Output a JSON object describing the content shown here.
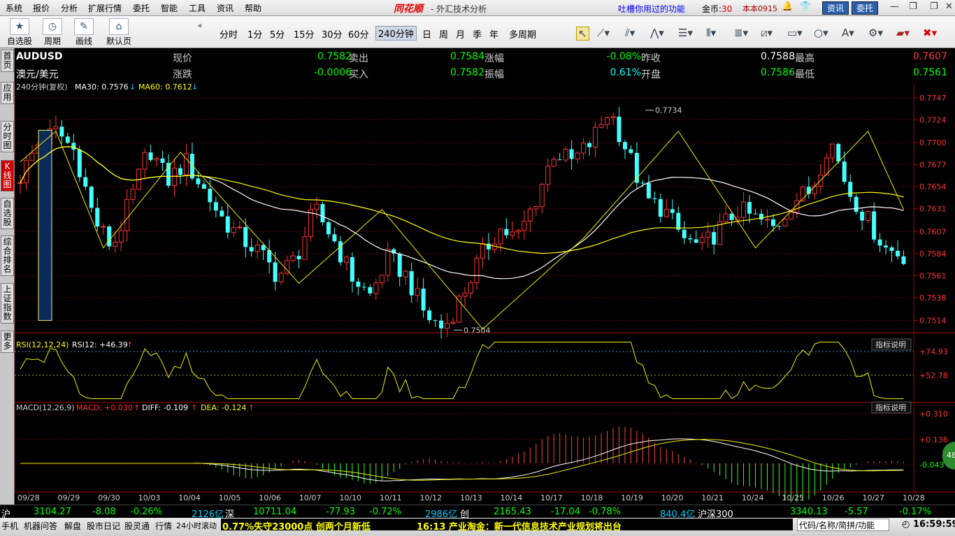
{
  "menu": [
    "系统",
    "报价",
    "分析",
    "扩展行情",
    "委托",
    "智能",
    "工具",
    "资讯",
    "帮助"
  ],
  "app": {
    "logo": "同花顺",
    "subtitle": "- 外汇技术分析",
    "tip": "吐槽你用过的功能",
    "coins_label": "金币:",
    "coins_value": "30",
    "version": "本本0915",
    "btn_news": "资讯",
    "btn_trade": "委托"
  },
  "toolbar": {
    "groups": [
      {
        "label": "自选股",
        "icon": "star-icon"
      },
      {
        "label": "周期",
        "icon": "clock-icon"
      },
      {
        "label": "画线",
        "icon": "pencil-icon"
      },
      {
        "label": "默认页",
        "icon": "home-icon"
      }
    ],
    "periods": [
      "分时",
      "1分",
      "5分",
      "15分",
      "30分",
      "60分",
      "240分钟",
      "日",
      "周",
      "月",
      "季",
      "年",
      "多周期"
    ],
    "selected_period": "240分钟"
  },
  "left_tabs": [
    "首页",
    "应用",
    "分时图",
    "K线图",
    "自选股",
    "综合排名",
    "上证指数",
    "更多"
  ],
  "quote": {
    "symbol": "AUDUSD",
    "name": "澳元/美元",
    "rows": [
      {
        "l1": "现价",
        "v1": "0.7582",
        "l2": "卖出",
        "v2": "0.7584",
        "l3": "涨幅",
        "v3": "-0.08%",
        "l4": "昨收",
        "v4": "0.7588",
        "l5": "最高",
        "v5": "0.7607"
      },
      {
        "l1": "涨跌",
        "v1": "-0.0006",
        "l2": "买入",
        "v2": "0.7582",
        "l3": "振幅",
        "v3": "0.61%",
        "l4": "开盘",
        "v4": "0.7586",
        "l5": "最低",
        "v5": "0.7561"
      }
    ]
  },
  "chart_data": {
    "type": "candlestick",
    "period_label": "240分钟(复权)",
    "ma_legend": [
      {
        "text": "MA30: 0.7576",
        "color": "#ffffff"
      },
      {
        "text": "MA60: 0.7612",
        "color": "#ffff00"
      }
    ],
    "price_axis": [
      "0.7747",
      "0.7724",
      "0.7700",
      "0.7677",
      "0.7654",
      "0.7631",
      "0.7607",
      "0.7584",
      "0.7561",
      "0.7538",
      "0.7514"
    ],
    "ylim": [
      0.7502,
      0.7755
    ],
    "high_label": "0.7734",
    "low_label": "0.7504",
    "dates": [
      "09/28",
      "09/29",
      "09/30",
      "10/03",
      "10/04",
      "10/05",
      "10/06",
      "10/07",
      "10/10",
      "10/11",
      "10/12",
      "10/13",
      "10/14",
      "10/17",
      "10/18",
      "10/19",
      "10/20",
      "10/21",
      "10/24",
      "10/25",
      "10/26",
      "10/27",
      "10/28"
    ],
    "close_path": [
      0.7665,
      0.77,
      0.7712,
      0.769,
      0.762,
      0.759,
      0.764,
      0.7695,
      0.766,
      0.768,
      0.765,
      0.762,
      0.76,
      0.7585,
      0.756,
      0.758,
      0.763,
      0.76,
      0.756,
      0.754,
      0.758,
      0.756,
      0.752,
      0.7505,
      0.754,
      0.758,
      0.761,
      0.76,
      0.764,
      0.769,
      0.768,
      0.77,
      0.7735,
      0.769,
      0.764,
      0.763,
      0.76,
      0.759,
      0.761,
      0.763,
      0.762,
      0.761,
      0.764,
      0.765,
      0.7705,
      0.765,
      0.762,
      0.759,
      0.7582
    ],
    "rsi": {
      "label": "RSI(12,12,24)",
      "value_label": "RSI12: +46.39",
      "axis": [
        "+74.93",
        "+52.78"
      ],
      "button": "指标说明"
    },
    "macd": {
      "label": "MACD(12,26,9)",
      "macd": "MACD: +0.030",
      "diff": "DIFF: -0.109",
      "dea": "DEA: -0.124",
      "axis": [
        "+0.310",
        "+0.136",
        "-0.043"
      ],
      "button": "指标说明"
    },
    "circle_badge": "48"
  },
  "status": {
    "sh_label": "沪",
    "sh_index": "3104.27",
    "sh_chg": "-8.08",
    "sh_pct": "-0.26%",
    "sh_amt": "2126亿",
    "sz_label": "深",
    "sz_index": "10711.04",
    "sz_chg": "-77.93",
    "sz_pct": "-0.72%",
    "sz_amt": "2986亿",
    "cy_label": "创",
    "cy_index": "2165.43",
    "cy_chg": "-17.04",
    "cy_pct": "-0.78%",
    "cy_amt": "840.4亿",
    "hs_label": "沪深300",
    "hs_index": "3340.13",
    "hs_chg": "-5.57",
    "hs_pct": "-0.17%"
  },
  "bottom": {
    "items": [
      "手机",
      "机器问答",
      "解盘",
      "股市日记",
      "股灵通",
      "行情",
      "24小时滚动"
    ],
    "news1": "0.77%失守23000点 创两个月新低",
    "news2": "16:13 产业淘金：新一代信息技术产业规划将出台",
    "search": "代码/名称/简拼/功能",
    "clock": "16:59:59"
  }
}
